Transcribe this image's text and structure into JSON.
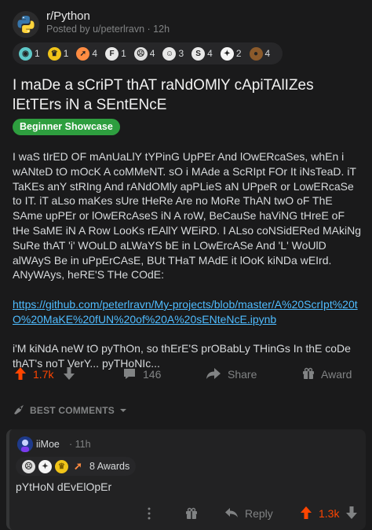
{
  "post": {
    "subreddit": "r/Python",
    "meta": "Posted by u/peterlravn · 12h",
    "title": "I maDe a sCriPT thAT raNdOMlY cApiTAlIZes lEtTErs iN a SEntENcE",
    "flair": "Beginner Showcase",
    "flair_color": "#2e9e3f",
    "paragraphs": [
      "I waS tIrED OF mAnUaLlY tYPinG UpPEr And lOwERcaSes, whEn i wANteD tO mOcK A coMMeNT. sO i MAde a ScRIpt FOr It iNsTeaD. iT TaKEs anY stRIng And rANdOMly apPLieS aN UPpeR or LowERcaSe to IT. iT aLso maKes sUre tHeRe Are no MoRe ThAN twO oF ThE SAme upPEr or lOwERcAseS iN A roW, BeCauSe haViNG tHreE oF tHe SaME iN A Row LooKs rEAllY WEiRD. I ALso coNSidERed MAkiNg SuRe thAT 'i' WOuLD aLWaYS bE in LOwErcASe And 'L' WoUlD alWAyS Be in uPpErCAsE, BUt THaT MAdE it lOoK kiNDa wEIrd. ANyWAys, heRE'S THe COdE:",
      "https://github.com/peterlravn/My-projects/blob/master/A%20ScrIpt%20tO%20MaKE%20fUN%20of%20A%20sENteNcE.ipynb",
      "i'M kiNdA neW tO pyThOn, so thErE'S prOBabLy THinGs In thE coDe thAT's noT VerY... pyTHoNIc..."
    ],
    "awards": [
      {
        "icon": "globe-award-icon",
        "count": "1",
        "color": "#5ec8c8"
      },
      {
        "icon": "helpful-award-icon",
        "count": "1",
        "color": "#f0c419"
      },
      {
        "icon": "rocket-award-icon",
        "count": "4",
        "color": "#ff8c42"
      },
      {
        "icon": "f-award-icon",
        "count": "1",
        "color": "#e8e8e8"
      },
      {
        "icon": "facepalm-award-icon",
        "count": "4",
        "color": "#e0e0e0"
      },
      {
        "icon": "laughing-award-icon",
        "count": "3",
        "color": "#e8e8e8"
      },
      {
        "icon": "s-award-icon",
        "count": "4",
        "color": "#e8e8e8"
      },
      {
        "icon": "cat-award-icon",
        "count": "2",
        "color": "#f5f5f5"
      },
      {
        "icon": "poop-award-icon",
        "count": "4",
        "color": "#8b5a2b"
      }
    ],
    "upvotes": "1.7k",
    "comments": "146",
    "share_label": "Share",
    "award_label": "Award"
  },
  "sort_label": "BEST COMMENTS",
  "comment": {
    "user": "iiMoe",
    "time": "· 11h",
    "awards_label": "8 Awards",
    "body": "pYtHoN dEvElOpEr",
    "reply_label": "Reply",
    "votes": "1.3k"
  },
  "colors": {
    "background": "#1a1a1b",
    "upvote": "#ff4500",
    "link": "#4fbcff"
  }
}
